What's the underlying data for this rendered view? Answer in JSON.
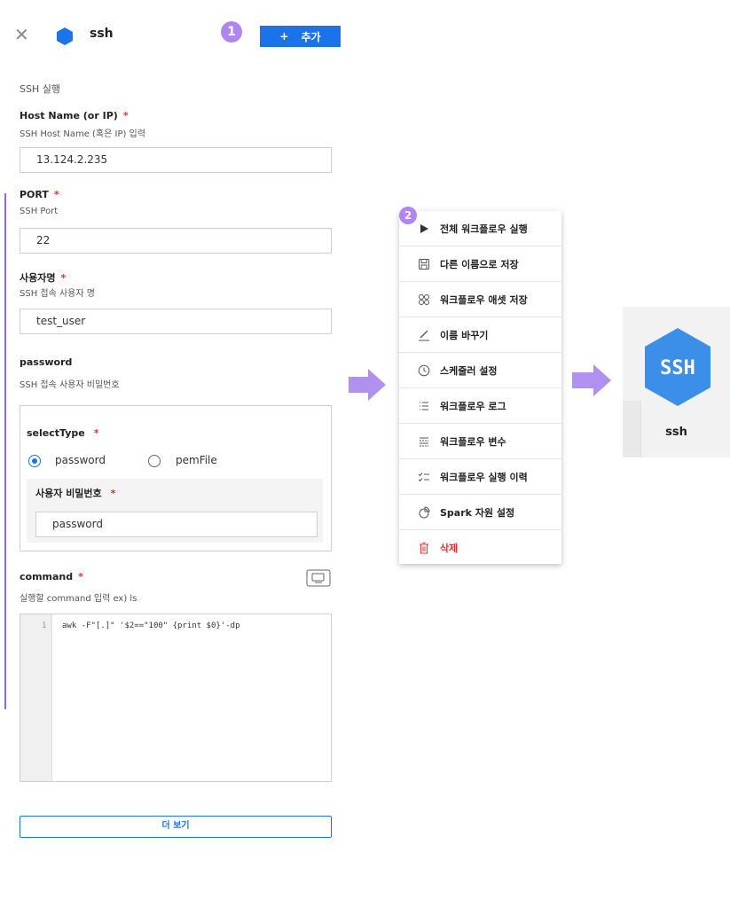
{
  "header": {
    "close_icon": "close-icon",
    "node_icon": "hexagon-icon",
    "title": "ssh",
    "step1": "1",
    "add_plus": "+",
    "add_label": "추가"
  },
  "form": {
    "description": "SSH 실행",
    "host": {
      "label": "Host Name (or IP)",
      "required": "*",
      "help": "SSH Host Name (혹은 IP) 입력",
      "value": "13.124.2.235"
    },
    "port": {
      "label": "PORT",
      "required": "*",
      "help": "SSH Port",
      "value": "22"
    },
    "user": {
      "label": "사용자명",
      "required": "*",
      "help": "SSH 접속 사용자 명",
      "value": "test_user"
    },
    "password": {
      "label": "password",
      "help": "SSH 접속 사용자 비밀번호"
    },
    "select_type": {
      "label": "selectType",
      "required": "*",
      "options": [
        "password",
        "pemFile"
      ],
      "selected": "password"
    },
    "user_password": {
      "label": "사용자 비밀번호",
      "required": "*",
      "value": "password"
    },
    "command": {
      "label": "command",
      "required": "*",
      "help": "실행할 command 입력 ex) ls",
      "line_no": "1",
      "code": "awk -F\"[.]\" '$2==\"100\" {print $0}'-dp"
    },
    "more_label": "더 보기"
  },
  "menu": {
    "step2": "2",
    "items": [
      {
        "icon": "play-icon",
        "label": "전체 워크플로우 실행"
      },
      {
        "icon": "save-icon",
        "label": "다른 이름으로 저장"
      },
      {
        "icon": "asset-icon",
        "label": "워크플로우 애셋 저장"
      },
      {
        "icon": "pencil-icon",
        "label": "이름 바꾸기"
      },
      {
        "icon": "clock-icon",
        "label": "스케줄러 설정"
      },
      {
        "icon": "list-icon",
        "label": "워크플로우 로그"
      },
      {
        "icon": "variable-icon",
        "label": "워크플로우 변수"
      },
      {
        "icon": "checklist-icon",
        "label": "워크플로우 실행 이력"
      },
      {
        "icon": "pie-icon",
        "label": "Spark 자원 설정"
      },
      {
        "icon": "trash-icon",
        "label": "삭제",
        "color": "#e03131"
      }
    ]
  },
  "node": {
    "icon_text": "SSH",
    "name": "ssh",
    "color": "#3b8fe8"
  }
}
